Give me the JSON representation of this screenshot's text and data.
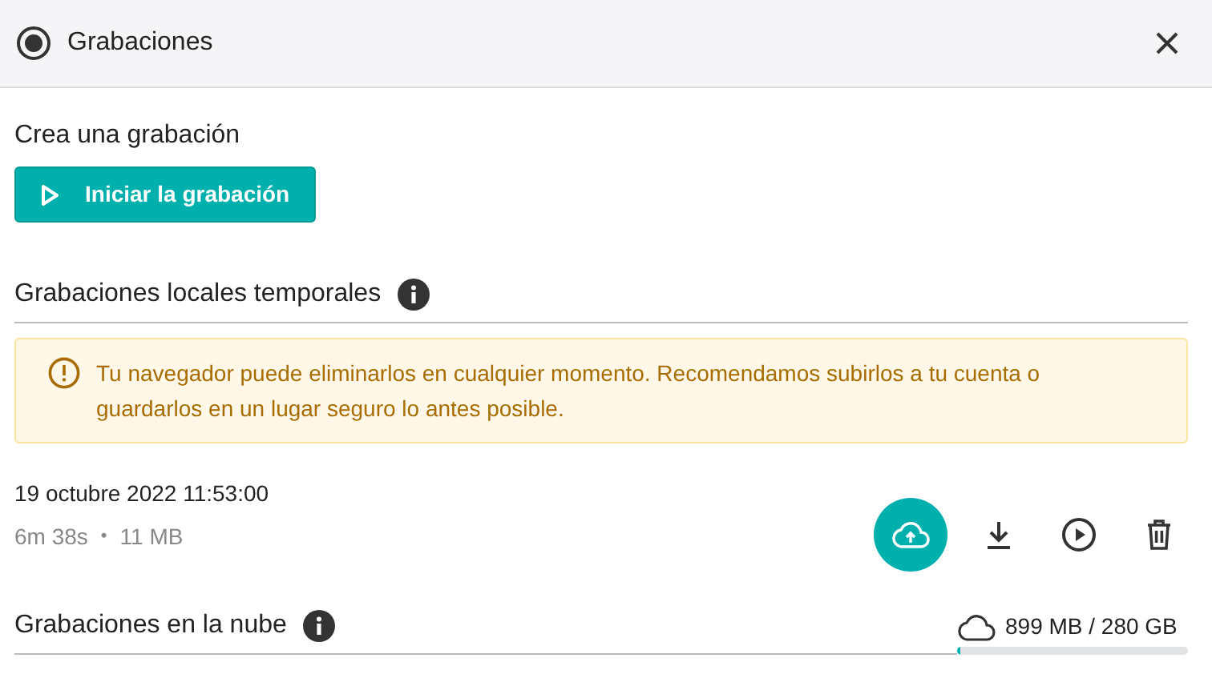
{
  "window": {
    "title": "Grabaciones"
  },
  "create": {
    "heading": "Crea una grabación",
    "button": "Iniciar la grabación"
  },
  "local": {
    "heading": "Grabaciones locales temporales",
    "warning": "Tu navegador puede eliminarlos en cualquier momento. Recomendamos subirlos a tu cuenta o guardarlos en un lugar seguro lo antes posible.",
    "recordings": [
      {
        "date": "19 octubre 2022 11:53:00",
        "duration": "6m 38s",
        "separator": "•",
        "size": "11 MB"
      }
    ]
  },
  "cloud": {
    "heading": "Grabaciones en la nube",
    "storage": {
      "reading": "899 MB / 280 GB",
      "level": 0.003
    }
  }
}
